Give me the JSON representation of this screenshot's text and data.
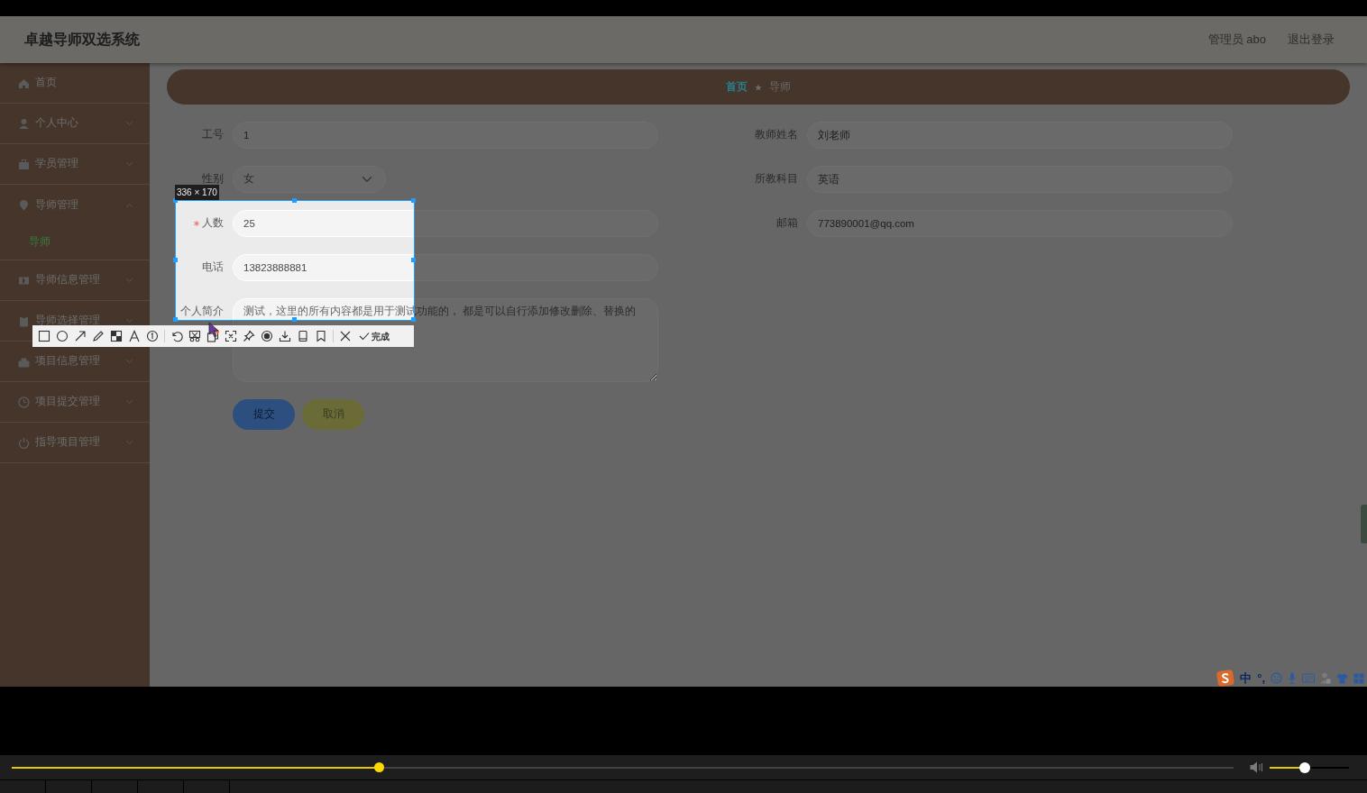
{
  "header": {
    "title": "卓越导师双选系统",
    "user": "管理员 abo",
    "logout": "退出登录"
  },
  "sidebar": {
    "items": [
      {
        "label": "首页",
        "kind": "link"
      },
      {
        "label": "个人中心",
        "kind": "group",
        "expanded": false
      },
      {
        "label": "学员管理",
        "kind": "group",
        "expanded": false
      },
      {
        "label": "导师管理",
        "kind": "group",
        "expanded": true,
        "children": [
          {
            "label": "导师",
            "selected": true
          }
        ]
      },
      {
        "label": "导师信息管理",
        "kind": "group",
        "expanded": false
      },
      {
        "label": "导师选择管理",
        "kind": "group",
        "expanded": false
      },
      {
        "label": "项目信息管理",
        "kind": "group",
        "expanded": false
      },
      {
        "label": "项目提交管理",
        "kind": "group",
        "expanded": false
      },
      {
        "label": "指导项目管理",
        "kind": "group",
        "expanded": false
      }
    ]
  },
  "breadcrumb": [
    {
      "label": "首页",
      "kind": "link"
    },
    {
      "label": "导师",
      "kind": "current"
    }
  ],
  "form": {
    "left": [
      {
        "label": "工号",
        "kind": "input",
        "value": "1"
      },
      {
        "label": "性别",
        "kind": "select",
        "value": "女"
      },
      {
        "label": "人数",
        "kind": "input",
        "value": "25",
        "required": true
      },
      {
        "label": "电话",
        "kind": "input",
        "value": "13823888881"
      },
      {
        "label": "个人简介",
        "kind": "textarea",
        "value": "测试，这里的所有内容都是用于测试功能的， 都是可以自行添加修改删除、替换的"
      }
    ],
    "right": [
      {
        "label": "教师姓名",
        "value": "刘老师"
      },
      {
        "label": "所教科目",
        "value": "英语"
      },
      {
        "label": "邮箱",
        "value": "773890001@qq.com"
      }
    ],
    "buttons": [
      {
        "label": "提交",
        "kind": "primary"
      },
      {
        "label": "取消",
        "kind": "secondary"
      }
    ]
  },
  "screenshot_tool": {
    "size": "336 × 170",
    "done": "完成"
  },
  "ime": {
    "mode": "中",
    "punctuation": "°,"
  },
  "player": {
    "progress": {
      "level": 0.3
    },
    "volume": {
      "level": 0.44
    }
  }
}
